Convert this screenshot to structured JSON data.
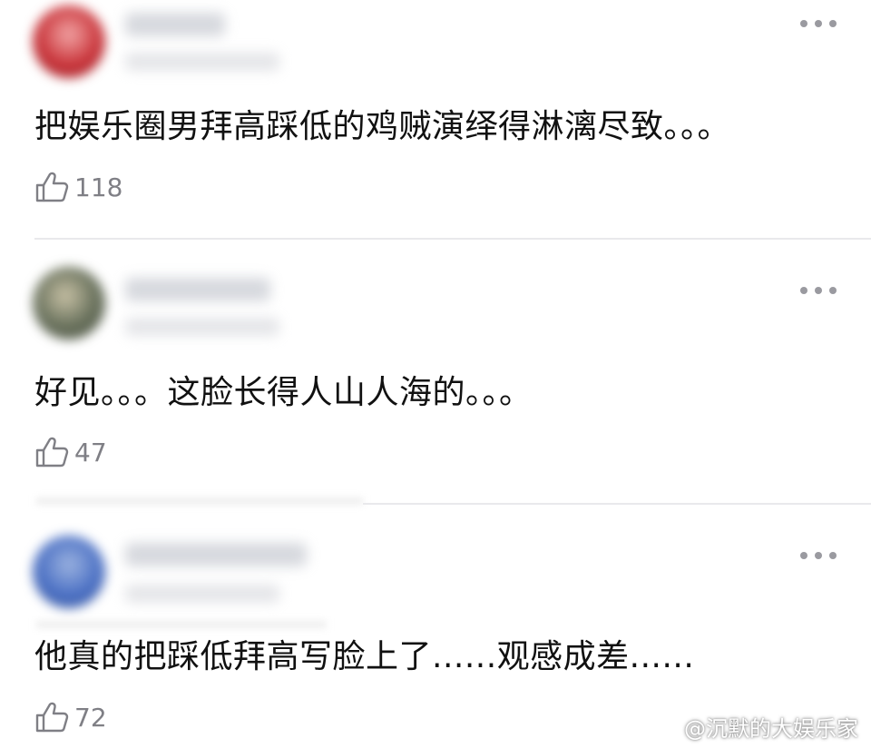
{
  "comments": [
    {
      "avatar_color": "#c9343a",
      "text": "把娱乐圈男拜高踩低的鸡贼演绎得淋漓尽致。。。",
      "likes": "118"
    },
    {
      "avatar_color": "#4f5a48",
      "text": "好见。。。这脸长得人山人海的。。。",
      "likes": "47"
    },
    {
      "avatar_color": "#4b70c4",
      "text": "他真的把踩低拜高写脸上了......观感成差......",
      "likes": "72"
    }
  ],
  "watermark": {
    "text": "@沉默的大娱乐家"
  },
  "icons": {
    "like": "thumbs-up-icon",
    "more": "more-dots-icon",
    "weibo": "weibo-logo-icon"
  }
}
